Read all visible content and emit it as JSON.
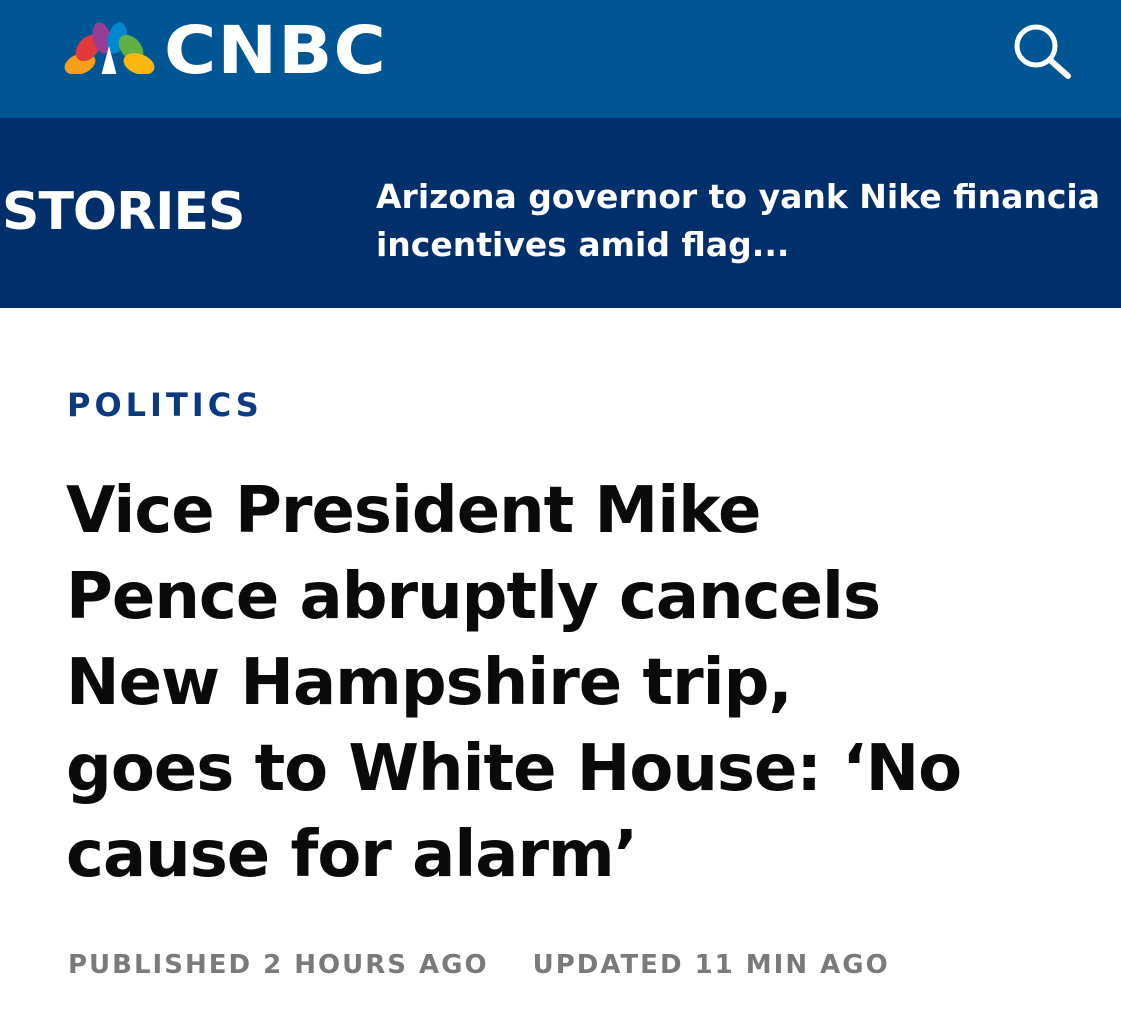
{
  "header": {
    "logo_text": "CNBC",
    "logo_icon": "nbc-peacock-icon",
    "search_icon": "search-icon",
    "background_color": "#005594"
  },
  "ticker": {
    "label": "STORIES",
    "headline_lines": [
      "Arizona governor to yank Nike financia",
      "incentives amid flag..."
    ],
    "background_color": "#002f6c"
  },
  "article": {
    "section": "POLITICS",
    "section_color": "#0b3a80",
    "headline_lines": [
      "Vice President Mike",
      "Pence abruptly cancels",
      "New Hampshire trip,",
      "goes to White House: ‘No",
      "cause for alarm’"
    ],
    "published": "PUBLISHED 2 HOURS AGO",
    "updated": "UPDATED 11 MIN AGO",
    "meta_color": "#7a7a7a"
  }
}
